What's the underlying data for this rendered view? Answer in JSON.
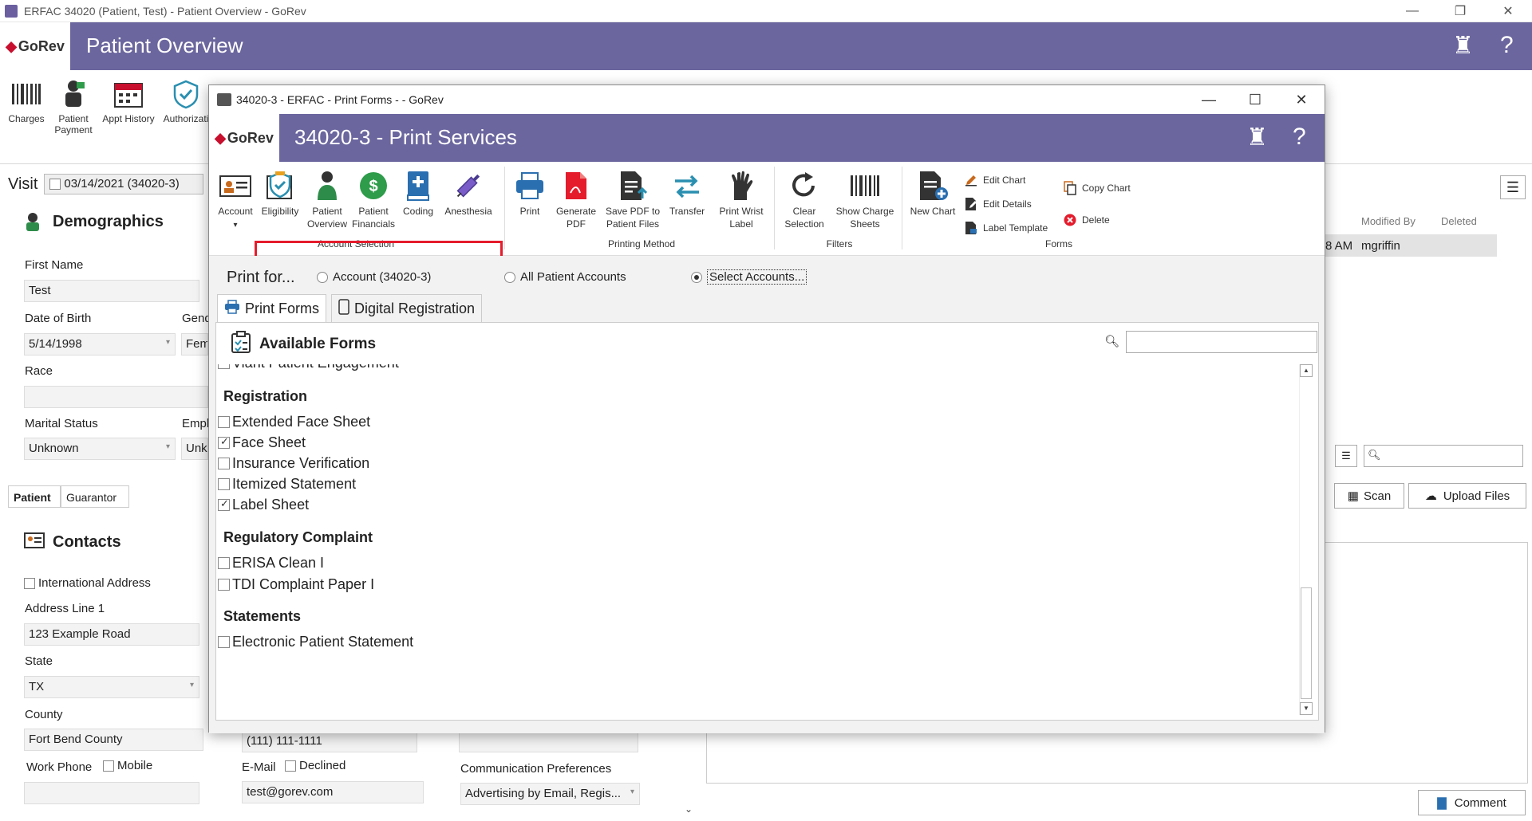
{
  "outer": {
    "window_title": "ERFAC 34020 (Patient, Test) - Patient Overview - GoRev",
    "logo": "GoRev",
    "header_title": "Patient Overview",
    "ribbon": [
      {
        "label": "Charges",
        "icon": "barcode-icon"
      },
      {
        "label": "Patient Payment",
        "icon": "payment-icon"
      },
      {
        "label": "Appt History",
        "icon": "calendar-icon"
      },
      {
        "label": "Authorizati",
        "icon": "shield-check-icon"
      }
    ]
  },
  "visit": {
    "label": "Visit",
    "value": "03/14/2021 (34020-3)"
  },
  "demographics": {
    "title": "Demographics",
    "first_name_label": "First Name",
    "first_name": "Test",
    "dob_label": "Date of Birth",
    "dob": "5/14/1998",
    "gender_label": "Gend",
    "gender": "Fem",
    "race_label": "Race",
    "race": "",
    "marital_label": "Marital Status",
    "marital": "Unknown",
    "employment_label": "Empl",
    "employment": "Unk",
    "tabs": [
      "Patient",
      "Guarantor"
    ]
  },
  "contacts": {
    "title": "Contacts",
    "intl_label": "International Address",
    "addr1_label": "Address Line 1",
    "addr1": "123 Example Road",
    "state_label": "State",
    "state": "TX",
    "county_label": "County",
    "county": "Fort Bend County",
    "phone": "(111) 111-1111",
    "work_phone_label": "Work Phone",
    "mobile_label": "Mobile",
    "email_label": "E-Mail",
    "declined_label": "Declined",
    "email": "test@gorev.com",
    "comm_label": "Communication Preferences",
    "comm": "Advertising by Email, Regis..."
  },
  "right_panel": {
    "col_modified_by": "Modified By",
    "col_deleted": "Deleted",
    "row_time": "8 AM",
    "row_user": "mgriffin",
    "scan": "Scan",
    "upload": "Upload Files",
    "comment": "Comment"
  },
  "modal": {
    "window_title": "34020-3 - ERFAC - Print Forms -  - GoRev",
    "logo": "GoRev",
    "header_title": "34020-3 - Print Services",
    "account_selection": {
      "group": "Account Selection",
      "buttons": [
        {
          "label": "Account",
          "icon": "account-card-icon"
        },
        {
          "label": "Eligibility",
          "icon": "eligibility-shield-icon"
        },
        {
          "label": "Patient Overview",
          "icon": "patient-icon"
        },
        {
          "label": "Patient Financials",
          "icon": "dollar-icon"
        },
        {
          "label": "Coding",
          "icon": "book-plus-icon"
        },
        {
          "label": "Anesthesia",
          "icon": "syringe-icon"
        }
      ]
    },
    "printing_method": {
      "group": "Printing Method",
      "buttons": [
        {
          "label": "Print",
          "icon": "printer-icon"
        },
        {
          "label": "Generate PDF",
          "icon": "pdf-icon"
        },
        {
          "label": "Save PDF to Patient Files",
          "icon": "save-pdf-icon"
        },
        {
          "label": "Transfer",
          "icon": "transfer-icon"
        },
        {
          "label": "Print Wrist Label",
          "icon": "wrist-label-icon"
        }
      ]
    },
    "filters": {
      "group": "Filters",
      "buttons": [
        {
          "label": "Clear Selection",
          "icon": "refresh-icon"
        },
        {
          "label": "Show Charge Sheets",
          "icon": "barcode-icon"
        }
      ]
    },
    "forms": {
      "group": "Forms",
      "new_chart": "New Chart",
      "edit_chart": "Edit Chart",
      "edit_details": "Edit Details",
      "label_template": "Label Template",
      "copy_chart": "Copy Chart",
      "delete": "Delete"
    },
    "print_for": {
      "label": "Print for...",
      "options": [
        "Account (34020-3)",
        "All Patient Accounts",
        "Select Accounts..."
      ],
      "selected": "Select Accounts..."
    },
    "tabs": [
      "Print Forms",
      "Digital Registration"
    ],
    "available_forms": {
      "title": "Available Forms",
      "search_value": "",
      "partial_item": "Viant Patient Engagement",
      "groups": [
        {
          "name": "Registration",
          "items": [
            {
              "label": "Extended Face Sheet",
              "checked": false
            },
            {
              "label": "Face Sheet",
              "checked": true
            },
            {
              "label": "Insurance Verification",
              "checked": false
            },
            {
              "label": "Itemized Statement",
              "checked": false
            },
            {
              "label": "Label Sheet",
              "checked": true
            }
          ]
        },
        {
          "name": "Regulatory Complaint",
          "items": [
            {
              "label": "ERISA Clean I",
              "checked": false
            },
            {
              "label": "TDI Complaint Paper I",
              "checked": false
            }
          ]
        },
        {
          "name": "Statements",
          "items": [
            {
              "label": "Electronic Patient Statement",
              "checked": false
            }
          ]
        }
      ]
    }
  },
  "colors": {
    "header": "#6b669e",
    "highlight": "#e41c2c",
    "brand_red": "#c8102e"
  }
}
